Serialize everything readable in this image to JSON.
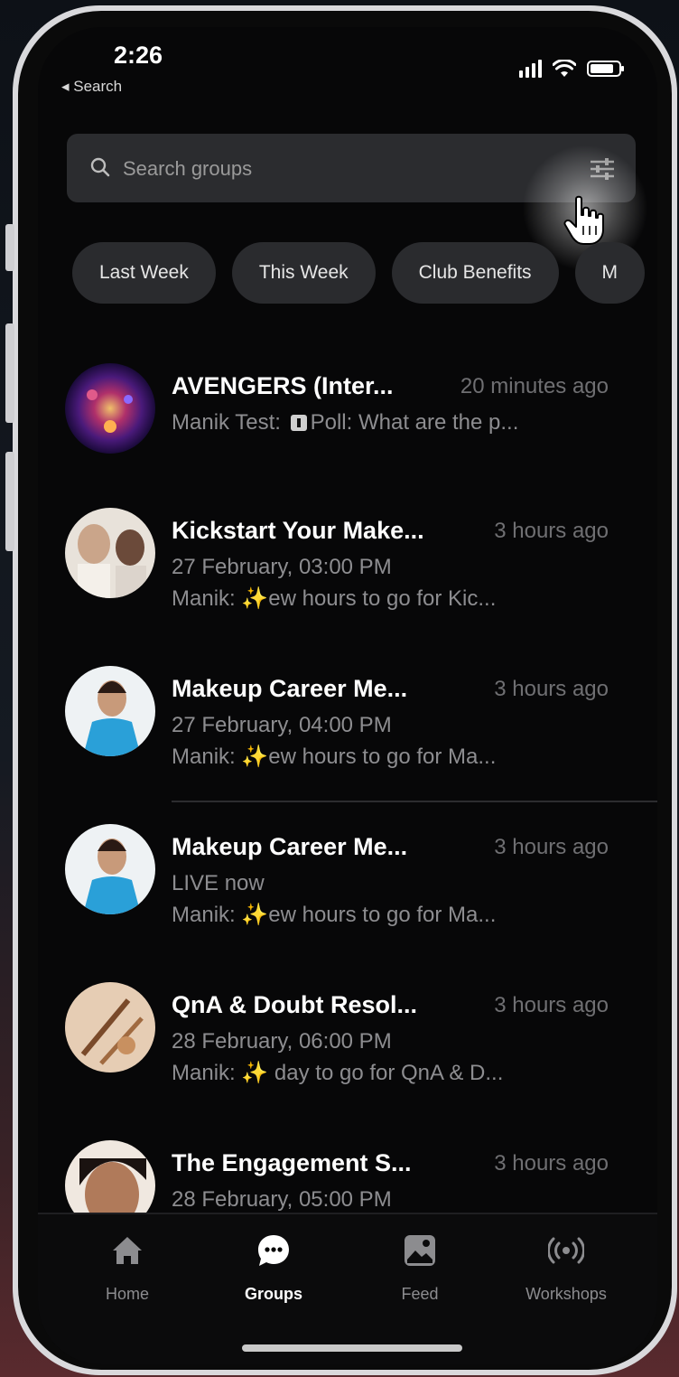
{
  "status": {
    "time": "2:26",
    "back_label": "◂ Search"
  },
  "search": {
    "placeholder": "Search groups"
  },
  "chips": [
    {
      "label": "Last Week"
    },
    {
      "label": "This Week"
    },
    {
      "label": "Club Benefits"
    },
    {
      "label": "M"
    }
  ],
  "groups": [
    {
      "title": "AVENGERS (Inter...",
      "time": "20 minutes ago",
      "subtitle": "",
      "message": "Manik Test: ",
      "message_extra": "Poll: What are the p..."
    },
    {
      "title": "Kickstart Your Make...",
      "time": "3 hours ago",
      "subtitle": "27 February, 03:00 PM",
      "message": "Manik: ✨Few hours to go for Kic..."
    },
    {
      "title": "Makeup Career Me...",
      "time": "3 hours ago",
      "subtitle": "27 February, 04:00 PM",
      "message": "Manik: ✨Few hours to go for Ma..."
    },
    {
      "title": "Makeup Career Me...",
      "time": "3 hours ago",
      "subtitle": "LIVE now",
      "message": "Manik: ✨Few hours to go for Ma..."
    },
    {
      "title": "QnA & Doubt Resol...",
      "time": "3 hours ago",
      "subtitle": "28 February, 06:00 PM",
      "message": "Manik: ✨1 day to go for QnA & D..."
    },
    {
      "title": "The Engagement S...",
      "time": "3 hours ago",
      "subtitle": "28 February, 05:00 PM",
      "message": ""
    }
  ],
  "tabs": [
    {
      "label": "Home",
      "icon": "home-icon"
    },
    {
      "label": "Groups",
      "icon": "chat-bubble-icon"
    },
    {
      "label": "Feed",
      "icon": "image-icon"
    },
    {
      "label": "Workshops",
      "icon": "broadcast-icon"
    }
  ],
  "colors": {
    "background": "#070708",
    "chip": "#2a2b2e",
    "muted_text": "#8d8d90",
    "accent_spark": "#f2c94c"
  }
}
